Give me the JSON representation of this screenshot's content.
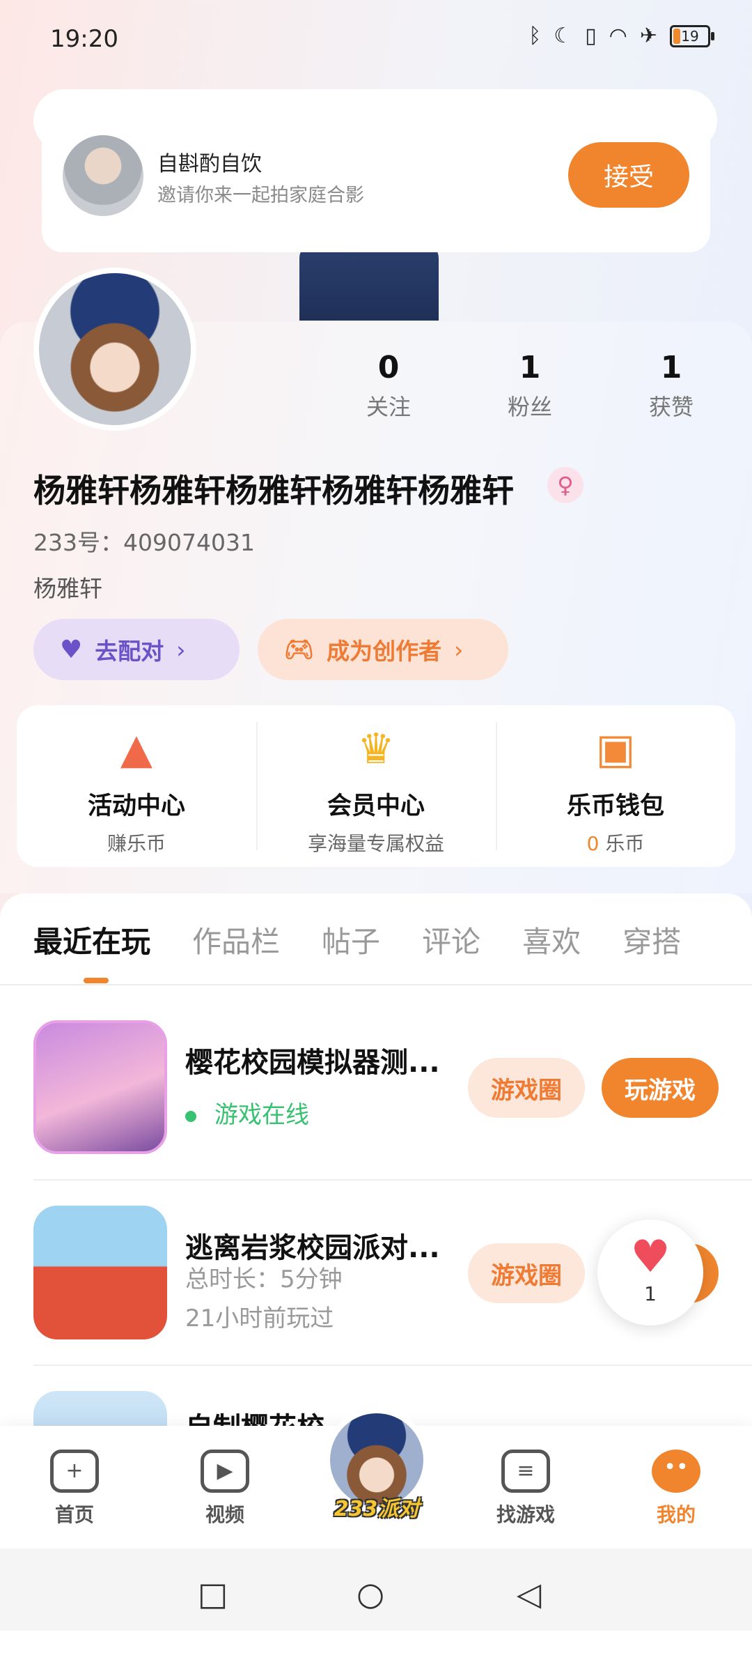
{
  "status_bar": {
    "time": "19:20",
    "battery": "19"
  },
  "invite": {
    "name": "自斟酌自饮",
    "message": "邀请你来一起拍家庭合影",
    "accept_label": "接受"
  },
  "profile": {
    "stats": [
      {
        "value": "0",
        "label": "关注"
      },
      {
        "value": "1",
        "label": "粉丝"
      },
      {
        "value": "1",
        "label": "获赞"
      }
    ],
    "username": "杨雅轩杨雅轩杨雅轩杨雅轩杨雅轩",
    "gender_symbol": "♀",
    "uid": "233号：409074031",
    "bio": "杨雅轩",
    "pair_label": "去配对",
    "creator_label": "成为创作者"
  },
  "shortcuts": [
    {
      "icon": "party-popper-icon",
      "title": "活动中心",
      "sub": "赚乐币",
      "sub_hl": ""
    },
    {
      "icon": "crown-icon",
      "title": "会员中心",
      "sub": "享海量专属权益",
      "sub_hl": ""
    },
    {
      "icon": "wallet-icon",
      "title": "乐币钱包",
      "sub": " 乐币",
      "sub_hl": "0"
    }
  ],
  "tabs": [
    "最近在玩",
    "作品栏",
    "帖子",
    "评论",
    "喜欢",
    "穿搭"
  ],
  "games": [
    {
      "title": "樱花校园模拟器测...",
      "status": "游戏在线",
      "circle_label": "游戏圈",
      "play_label": "玩游戏"
    },
    {
      "title": "逃离岩浆校园派对...",
      "duration": "总时长：5分钟",
      "last_played": "21小时前玩过",
      "circle_label": "游戏圈"
    },
    {
      "title": "自制樱花校"
    }
  ],
  "like_count": "1",
  "bottom_nav": {
    "home": "首页",
    "video": "视频",
    "party": "233派对",
    "find": "找游戏",
    "me": "我的"
  },
  "colors": {
    "accent": "#f0852e",
    "online": "#38c171",
    "pair": "#6b52c9"
  }
}
